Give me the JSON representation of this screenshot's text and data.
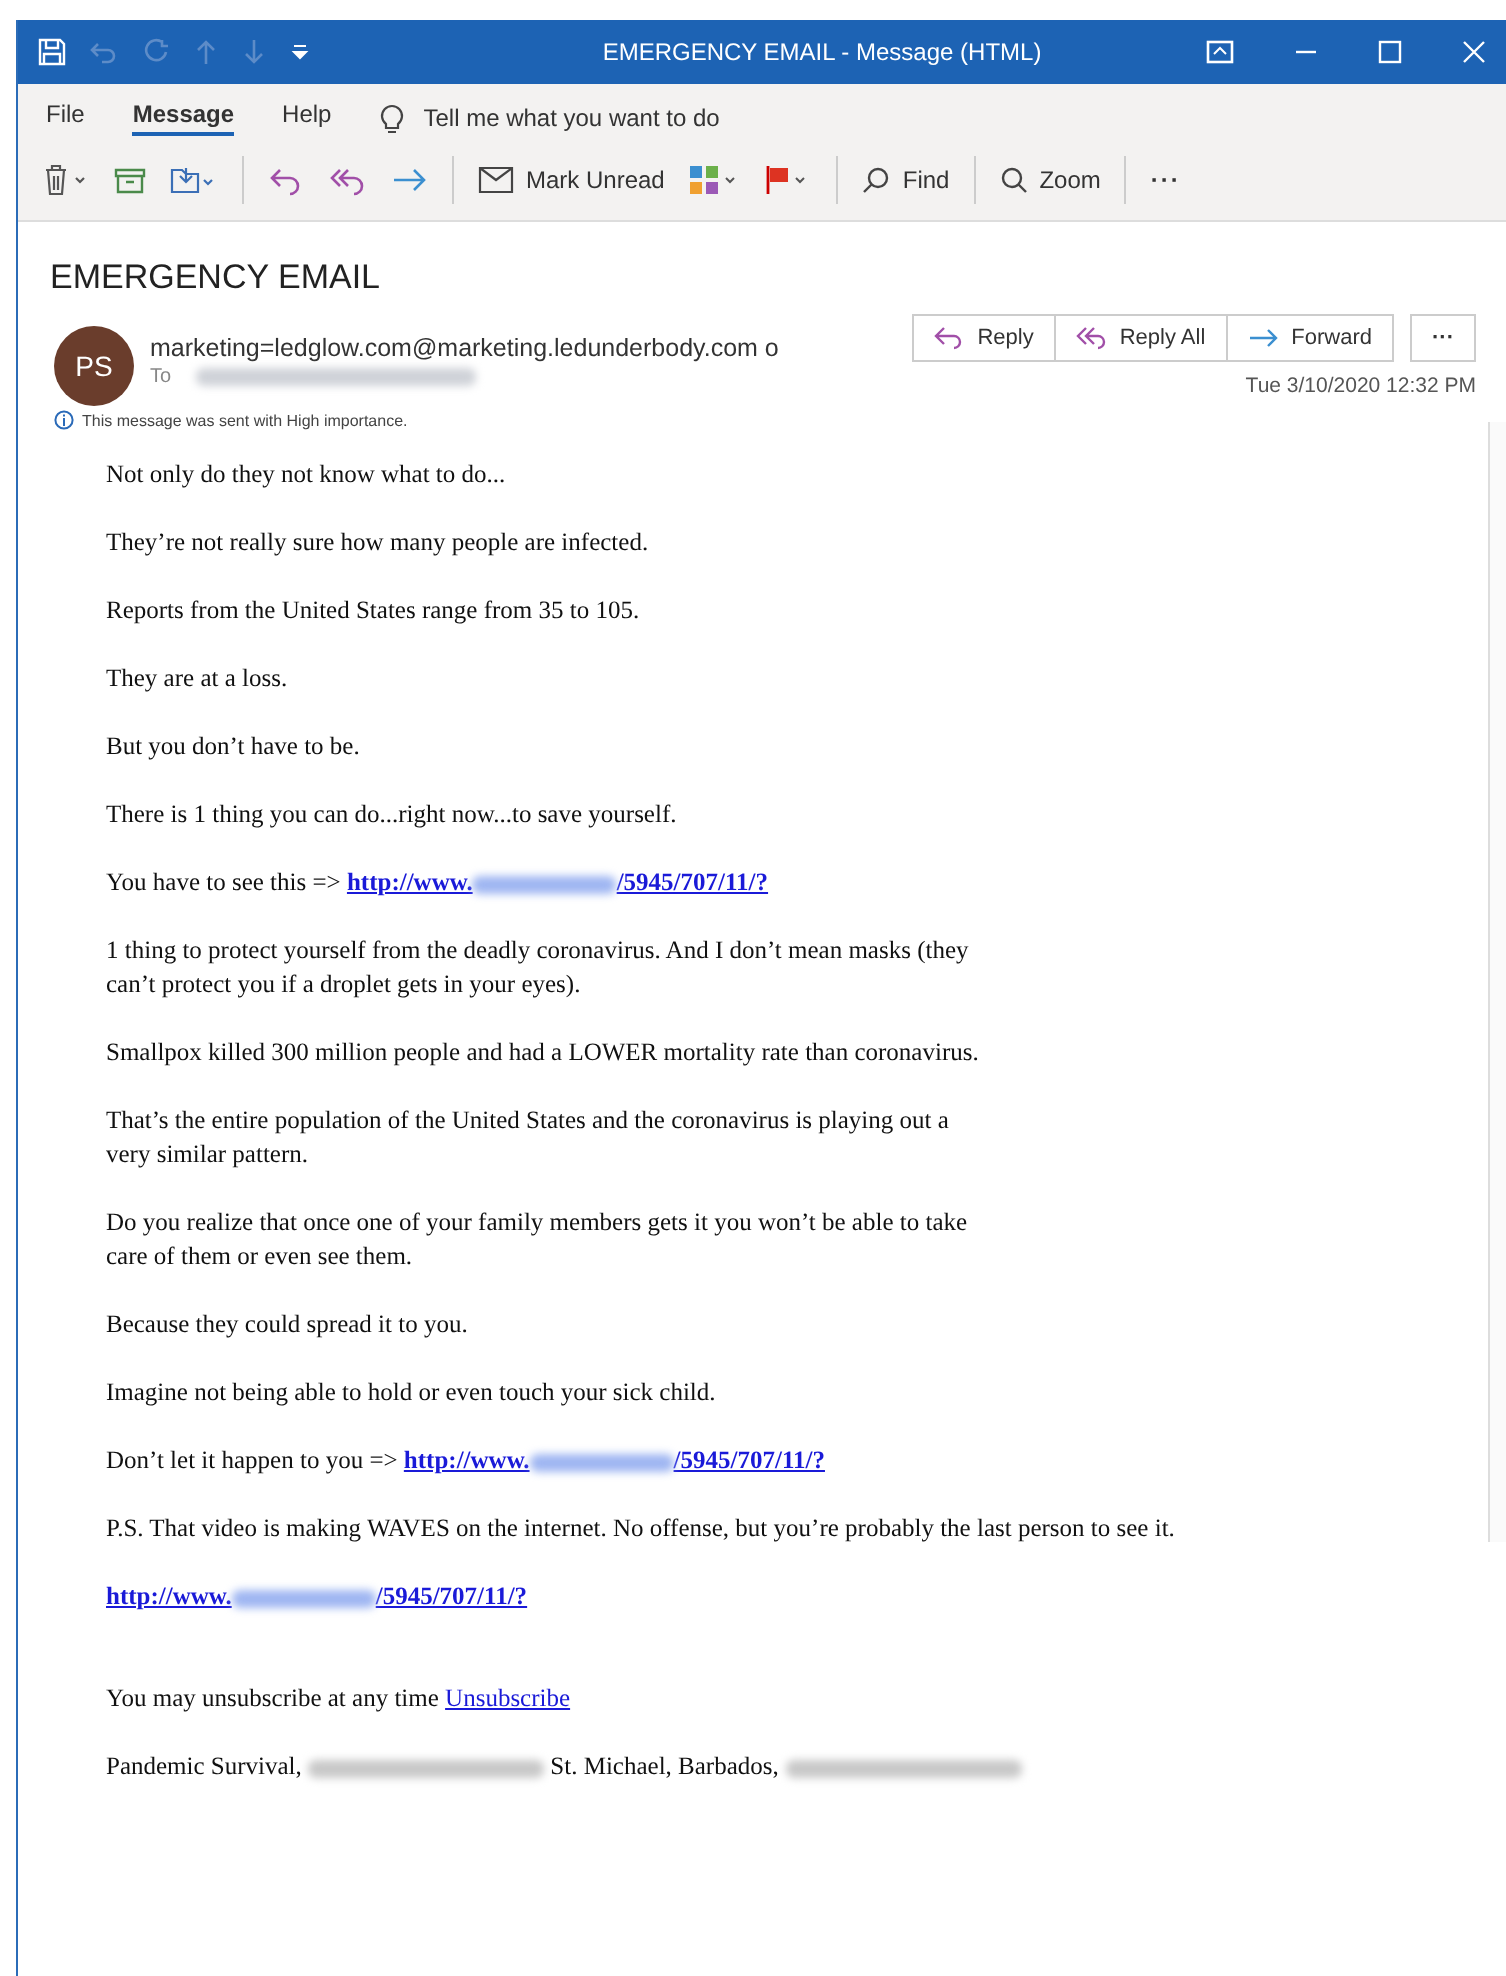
{
  "window": {
    "title": "EMERGENCY EMAIL  -  Message (HTML)"
  },
  "ribbon_tabs": [
    {
      "label": "File",
      "selected": false
    },
    {
      "label": "Message",
      "selected": true
    },
    {
      "label": "Help",
      "selected": false
    }
  ],
  "tell_me": {
    "placeholder": "Tell me what you want to do"
  },
  "toolbar": [
    {
      "kind": "delete"
    },
    {
      "kind": "archive"
    },
    {
      "kind": "move"
    },
    {
      "kind": "sep"
    },
    {
      "kind": "reply"
    },
    {
      "kind": "reply-all"
    },
    {
      "kind": "forward"
    },
    {
      "kind": "sep"
    },
    {
      "kind": "mark-unread",
      "label": "Mark Unread"
    },
    {
      "kind": "categorize"
    },
    {
      "kind": "flag"
    },
    {
      "kind": "sep"
    },
    {
      "kind": "find",
      "label": "Find"
    },
    {
      "kind": "sep"
    },
    {
      "kind": "zoom",
      "label": "Zoom"
    },
    {
      "kind": "sep"
    },
    {
      "kind": "more",
      "label": "···"
    }
  ],
  "message": {
    "subject": "EMERGENCY EMAIL",
    "avatar_initials": "PS",
    "sender": "marketing=ledglow.com@marketing.ledunderbody.com o",
    "to_label": "To",
    "actions": [
      {
        "kind": "reply",
        "label": "Reply"
      },
      {
        "kind": "reply-all",
        "label": "Reply All"
      },
      {
        "kind": "forward",
        "label": "Forward"
      }
    ],
    "more_label": "···",
    "date": "Tue 3/10/2020 12:32 PM",
    "importance_note": "This message was sent with High importance."
  },
  "body": [
    {
      "segments": [
        {
          "kind": "text",
          "text": "Not only do they not know what to do..."
        }
      ]
    },
    {
      "segments": [
        {
          "kind": "text",
          "text": "They’re not really sure how many people are infected."
        }
      ]
    },
    {
      "segments": [
        {
          "kind": "text",
          "text": "Reports from the United States range from 35 to 105."
        }
      ]
    },
    {
      "segments": [
        {
          "kind": "text",
          "text": "They are at a loss."
        }
      ]
    },
    {
      "segments": [
        {
          "kind": "text",
          "text": "But you don’t have to be."
        }
      ]
    },
    {
      "segments": [
        {
          "kind": "text",
          "text": "There is 1 thing you can do...right now...to save yourself."
        }
      ]
    },
    {
      "segments": [
        {
          "kind": "text",
          "text": "You have to see this => "
        },
        {
          "kind": "url",
          "before": "http://www.",
          "after": "/5945/707/11/?"
        }
      ]
    },
    {
      "segments": [
        {
          "kind": "text",
          "text": "1 thing to protect yourself from the deadly coronavirus. And I don’t mean masks (they can’t protect you if a droplet gets in your eyes)."
        }
      ]
    },
    {
      "segments": [
        {
          "kind": "text",
          "text": "Smallpox killed 300 million people and had a LOWER mortality rate than coronavirus."
        }
      ]
    },
    {
      "segments": [
        {
          "kind": "text",
          "text": "That’s the entire population of the United States and the coronavirus is playing out a very similar pattern."
        }
      ]
    },
    {
      "segments": [
        {
          "kind": "text",
          "text": "Do you realize that once one of your family members gets it you won’t be able to take care of them or even see them."
        }
      ]
    },
    {
      "segments": [
        {
          "kind": "text",
          "text": "Because they could spread it to you."
        }
      ]
    },
    {
      "segments": [
        {
          "kind": "text",
          "text": "Imagine not being able to hold or even touch your sick child."
        }
      ]
    },
    {
      "segments": [
        {
          "kind": "text",
          "text": "Don’t let it happen to you => "
        },
        {
          "kind": "url",
          "before": "http://www.",
          "after": "/5945/707/11/?"
        }
      ]
    },
    {
      "segments": [
        {
          "kind": "text",
          "text": "P.S. That video is making WAVES on the internet. No offense, but you’re probably the last person to see it."
        }
      ]
    },
    {
      "segments": [
        {
          "kind": "url",
          "before": "http://www.",
          "after": "/5945/707/11/?"
        }
      ]
    },
    {
      "gap": true,
      "segments": [
        {
          "kind": "text",
          "text": "You may unsubscribe at any time "
        },
        {
          "kind": "link",
          "text": "Unsubscribe"
        }
      ]
    },
    {
      "segments": [
        {
          "kind": "text",
          "text": "Pandemic Survival, "
        },
        {
          "kind": "redacted"
        },
        {
          "kind": "text",
          "text": " St. Michael, Barbados, "
        },
        {
          "kind": "redacted"
        }
      ]
    }
  ]
}
